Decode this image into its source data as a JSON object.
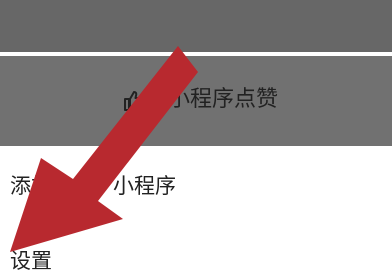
{
  "menu": {
    "like_label": "该小程序点赞",
    "add_label_prefix": "添加",
    "add_label_suffix": "小程序",
    "settings_label": "设置"
  },
  "colors": {
    "overlay_dark": "#676767",
    "overlay_row": "#717171",
    "panel": "#ffffff",
    "arrow": "#b8292f",
    "text": "#222222"
  },
  "icons": {
    "like": "thumbs-up-icon",
    "annotation": "red-arrow-pointer"
  }
}
